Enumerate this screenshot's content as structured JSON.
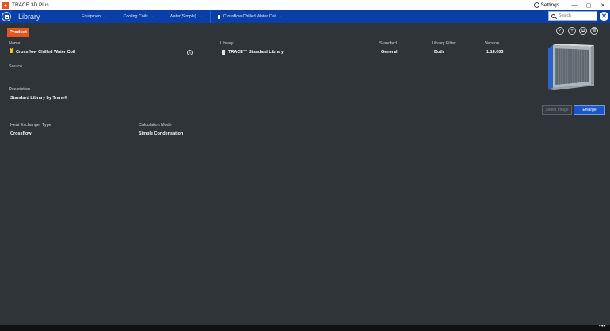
{
  "window": {
    "app_title": "TRACE 3D Plus",
    "settings_label": "Settings",
    "minimize": "—",
    "maximize": "▢",
    "close": "✕"
  },
  "nav": {
    "title": "Library",
    "breadcrumbs": [
      {
        "label": "Equipment"
      },
      {
        "label": "Cooling Coils"
      },
      {
        "label": "Water(Simple)"
      },
      {
        "label": "Crossflow Chilled Water Coil"
      }
    ],
    "search_placeholder": "Search",
    "close_symbol": "✕"
  },
  "product": {
    "tag": "Product",
    "name_label": "Name",
    "name_value": "Crossflow Chilled Water Coil",
    "library_label": "Library",
    "library_value": "TRACE™ Standard Library",
    "standard_label": "Standard",
    "standard_value": "General",
    "filter_label": "Library Filter",
    "filter_value": "Both",
    "version_label": "Version",
    "version_value": "1.18.003",
    "source_label": "Source",
    "description_label": "Description",
    "description_value": "Standard Library by Trane®",
    "hx_label": "Heat Exchanger Type",
    "hx_value": "Crossflow",
    "calc_label": "Calculation Mode",
    "calc_value": "Simple Condensation"
  },
  "image_actions": {
    "select_image": "Select Image",
    "enlarge": "Enlarge"
  },
  "icons": {
    "app": "trace-logo-icon",
    "settings": "gear-icon",
    "home": "home-icon",
    "search": "search-icon",
    "lock": "lock-icon",
    "edit": "edit-icon",
    "library": "library-book-icon",
    "actions": [
      "check-icon",
      "add-icon",
      "copy-icon",
      "delete-icon"
    ]
  },
  "colors": {
    "background": "#2e3438",
    "nav_blue": "#0a3fa8",
    "accent_orange": "#e8541e",
    "button_blue": "#1d55c6"
  }
}
